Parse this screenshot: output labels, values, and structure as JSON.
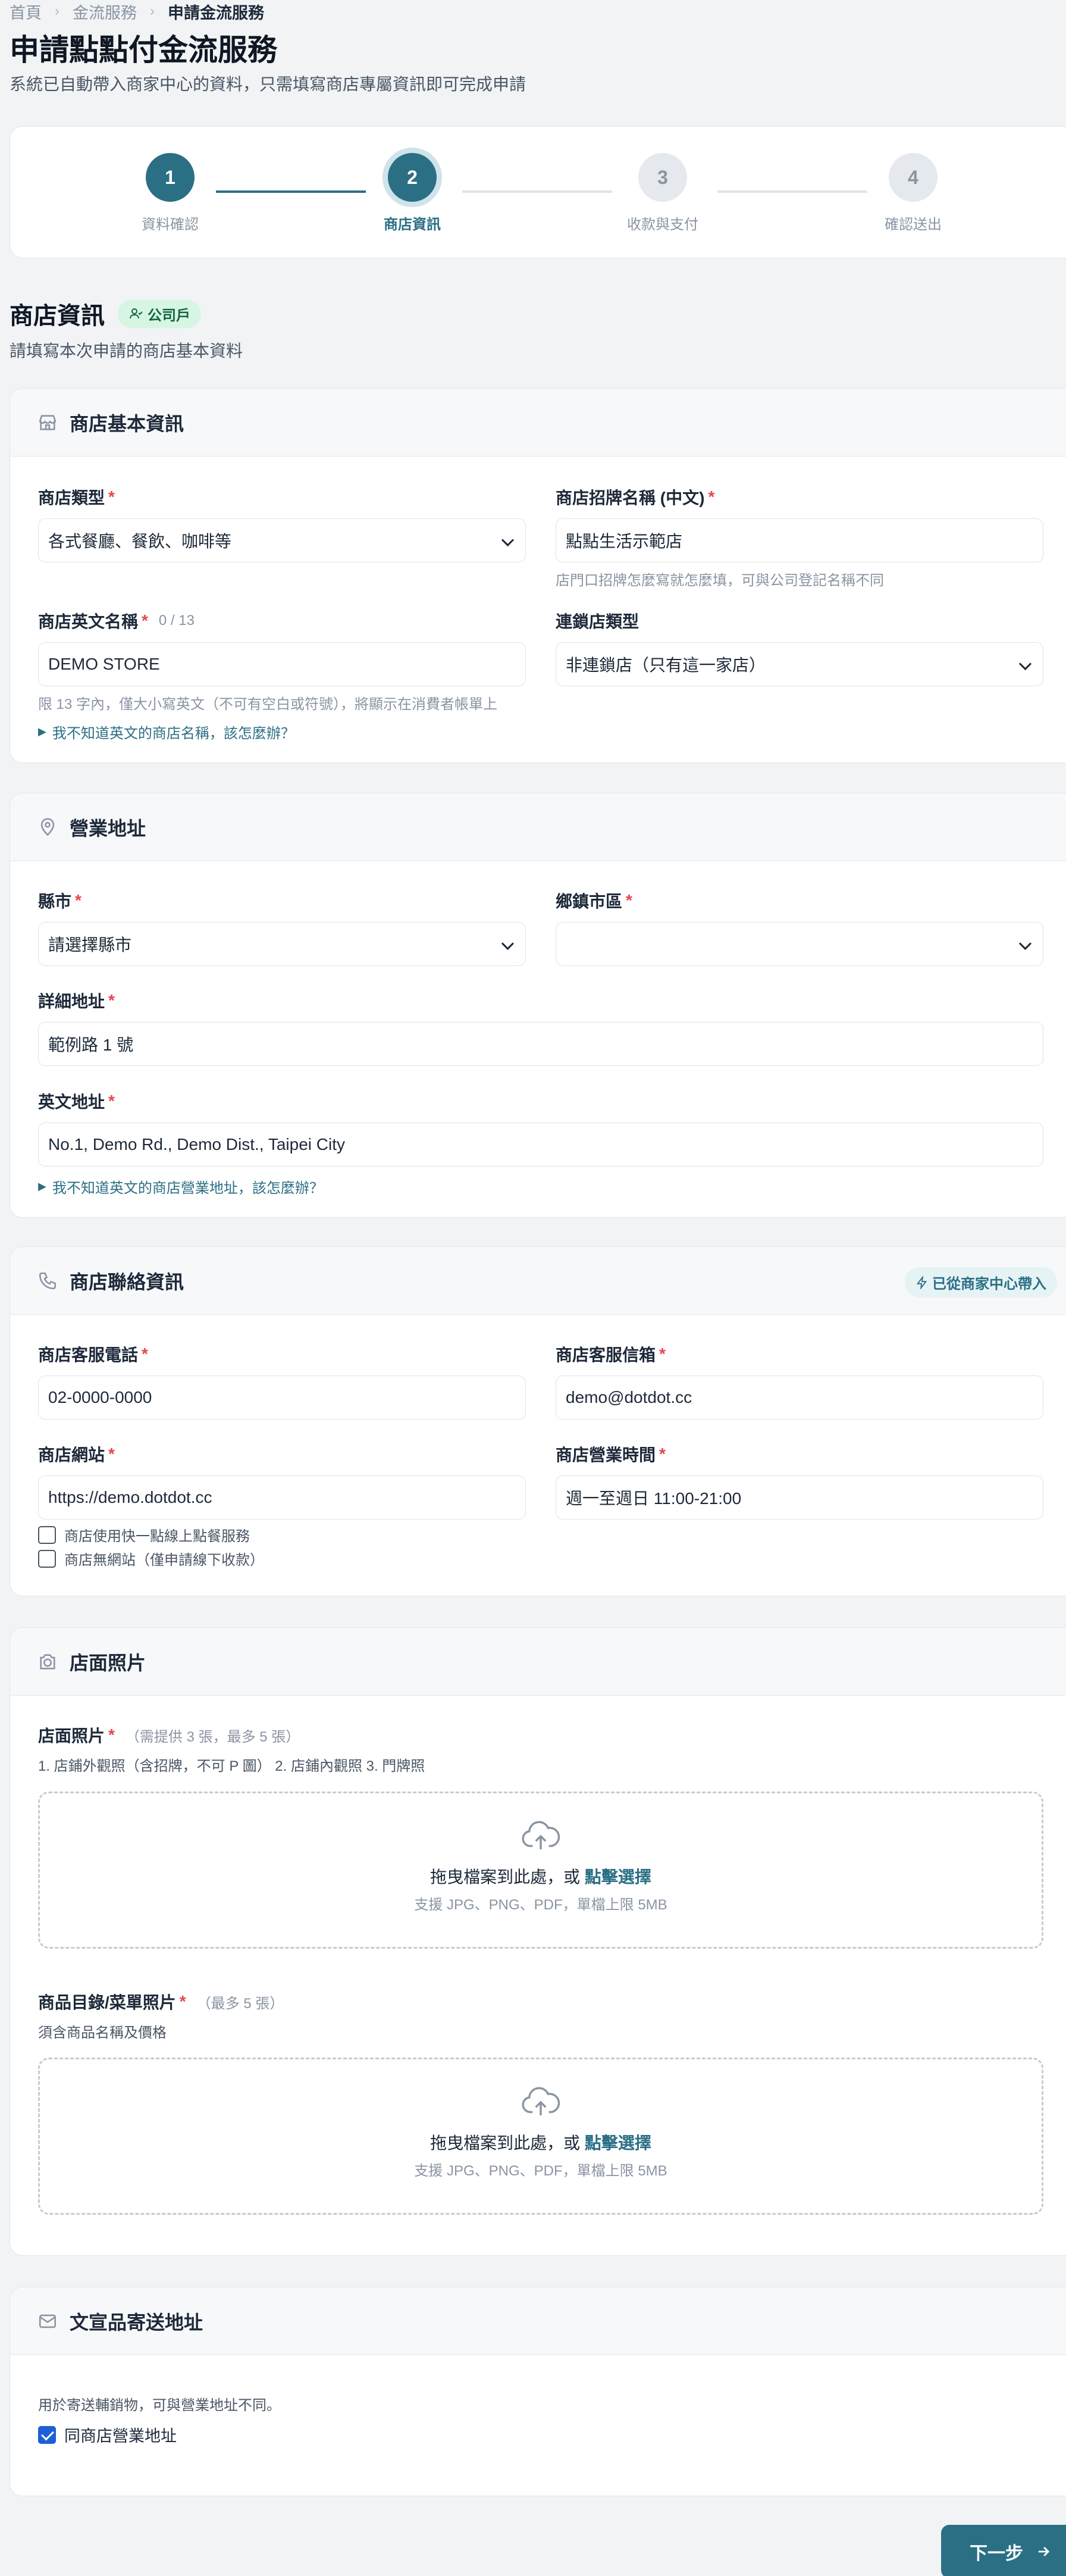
{
  "breadcrumb": {
    "home": "首頁",
    "services": "金流服務",
    "current": "申請金流服務"
  },
  "page": {
    "title": "申請點點付金流服務",
    "description": "系統已自動帶入商家中心的資料，只需填寫商店專屬資訊即可完成申請"
  },
  "steps": [
    {
      "number": "1",
      "label": "資料確認",
      "status": "done"
    },
    {
      "number": "2",
      "label": "商店資訊",
      "status": "active"
    },
    {
      "number": "3",
      "label": "收款與支付",
      "status": "todo"
    },
    {
      "number": "4",
      "label": "確認送出",
      "status": "todo"
    }
  ],
  "section": {
    "title": "商店資訊",
    "badge": "公司戶",
    "description": "請填寫本次申請的商店基本資料"
  },
  "basic_info": {
    "title": "商店基本資訊",
    "store_type": {
      "label": "商店類型",
      "value": "各式餐廳、餐飲、咖啡等"
    },
    "sign_name_zh": {
      "label": "商店招牌名稱 (中文)",
      "value": "點點生活示範店",
      "hint": "店門口招牌怎麼寫就怎麼填，可與公司登記名稱不同"
    },
    "name_en": {
      "label": "商店英文名稱",
      "counter": "0 / 13",
      "value": "DEMO STORE",
      "hint": "限 13 字內，僅大小寫英文（不可有空白或符號），將顯示在消費者帳單上"
    },
    "name_en_help": "我不知道英文的商店名稱，該怎麼辦？",
    "chain_type": {
      "label": "連鎖店類型",
      "value": "非連鎖店（只有這一家店）"
    }
  },
  "address": {
    "title": "營業地址",
    "city": {
      "label": "縣市",
      "value": "請選擇縣市"
    },
    "district": {
      "label": "鄉鎮市區",
      "value": ""
    },
    "detail": {
      "label": "詳細地址",
      "value": "範例路 1 號"
    },
    "english": {
      "label": "英文地址",
      "value": "No.1, Demo Rd., Demo Dist., Taipei City"
    },
    "english_help": "我不知道英文的商店營業地址，該怎麼辦？"
  },
  "contact": {
    "title": "商店聯絡資訊",
    "synced": "已從商家中心帶入",
    "phone": {
      "label": "商店客服電話",
      "value": "02-0000-0000"
    },
    "email": {
      "label": "商店客服信箱",
      "value": "demo@dotdot.cc"
    },
    "website": {
      "label": "商店網站",
      "value": "https://demo.dotdot.cc"
    },
    "hours": {
      "label": "商店營業時間",
      "value": "週一至週日 11:00-21:00"
    },
    "opt_online_order": "商店使用快一點線上點餐服務",
    "opt_no_website": "商店無網站（僅申請線下收款）"
  },
  "photos": {
    "title": "店面照片",
    "storefront": {
      "label": "店面照片",
      "note": "（需提供 3 張，最多 5 張）",
      "desc": "1. 店鋪外觀照（含招牌，不可 P 圖）  2. 店鋪內觀照  3. 門牌照"
    },
    "menu": {
      "label": "商品目錄/菜單照片",
      "note": "（最多 5 張）",
      "desc": "須含商品名稱及價格"
    },
    "dropzone": {
      "text": "拖曳檔案到此處，或",
      "action": "點擊選擇",
      "sub": "支援 JPG、PNG、PDF，單檔上限 5MB"
    }
  },
  "mailing": {
    "title": "文宣品寄送地址",
    "desc": "用於寄送輔銷物，可與營業地址不同。",
    "same_as_store": "同商店營業地址",
    "same_checked": true
  },
  "actions": {
    "next": "下一步"
  },
  "colors": {
    "primary": "#2b6f85",
    "required": "#e5484d",
    "badge_bg": "#d6f5e3"
  }
}
